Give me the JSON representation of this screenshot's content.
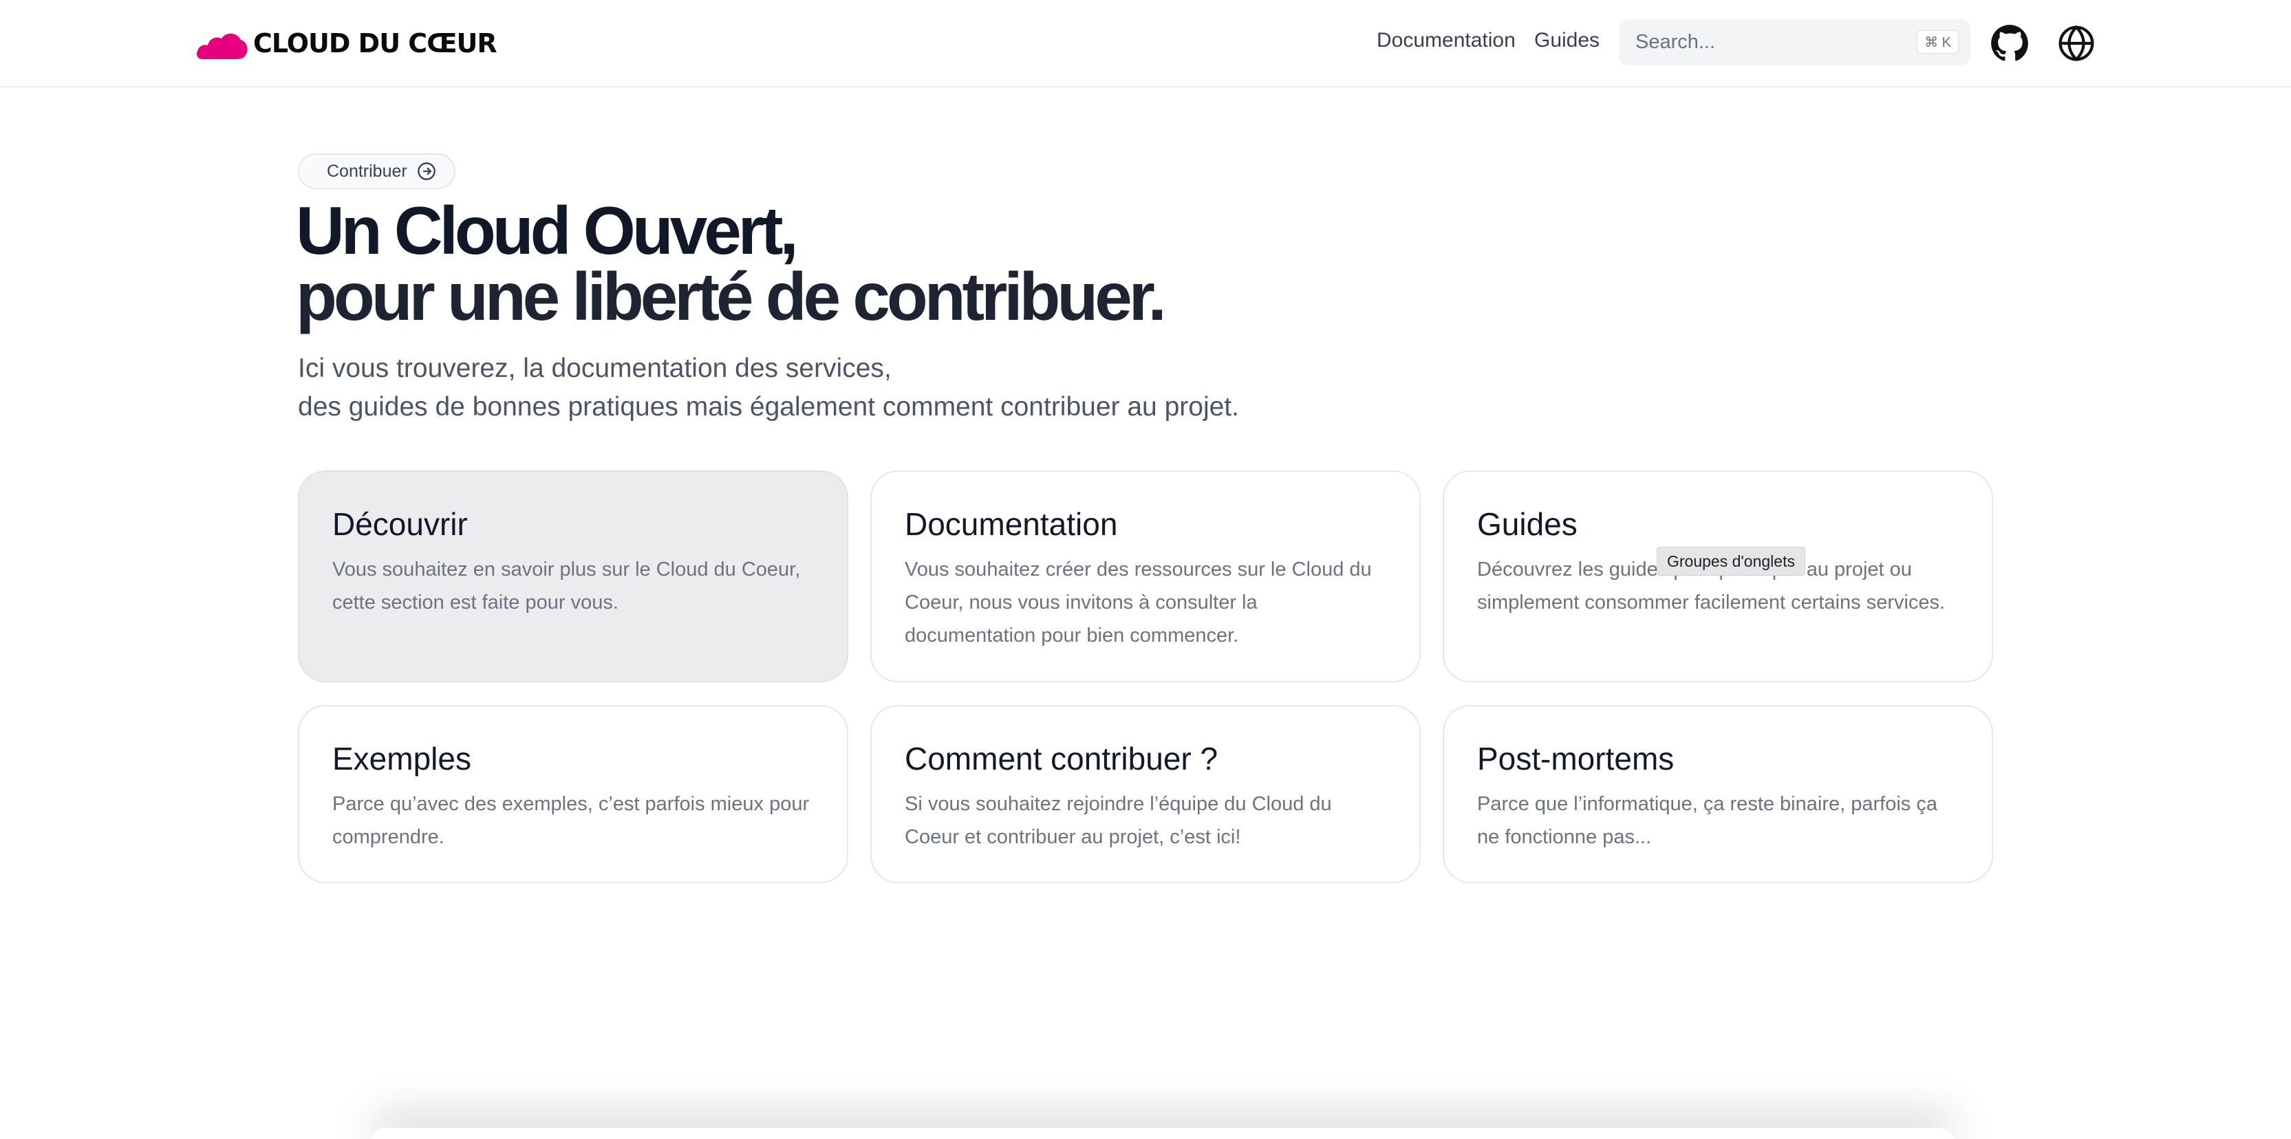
{
  "header": {
    "brand": "CLOUD DU CŒUR",
    "nav": [
      {
        "label": "Documentation"
      },
      {
        "label": "Guides"
      }
    ],
    "search": {
      "placeholder": "Search...",
      "shortcut": "⌘ K"
    },
    "icons": [
      "github-icon",
      "globe-icon"
    ],
    "brand_color": "#e6007e"
  },
  "hero": {
    "pill_label": "Contribuer",
    "title_line1": "Un Cloud Ouvert,",
    "title_line2": "pour une liberté de contribuer.",
    "subtitle_line1": "Ici vous trouverez, la documentation des services,",
    "subtitle_line2": "des guides de bonnes pratiques mais également comment contribuer au projet."
  },
  "cards": [
    {
      "title": "Découvrir",
      "description": "Vous souhaitez en savoir plus sur le Cloud du Coeur, cette section est faite pour vous."
    },
    {
      "title": "Documentation",
      "description": "Vous souhaitez créer des ressources sur le Cloud du Coeur, nous vous invitons à consulter la documentation pour bien commencer."
    },
    {
      "title": "Guides",
      "description": "Découvrez les guides pour participer au projet ou simplement consommer facilement certains services."
    },
    {
      "title": "Exemples",
      "description": "Parce qu’avec des exemples, c’est parfois mieux pour comprendre."
    },
    {
      "title": "Comment contribuer ?",
      "description": "Si vous souhaitez rejoindre l’équipe du Cloud du Coeur et contribuer au projet, c’est ici!"
    },
    {
      "title": "Post-mortems",
      "description": "Parce que l’informatique, ça reste binaire, parfois ça ne fonctionne pas..."
    }
  ],
  "tooltip": "Groupes d'onglets"
}
